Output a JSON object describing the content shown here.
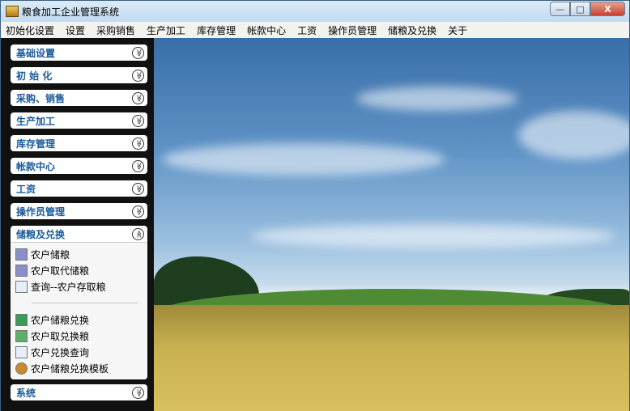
{
  "window": {
    "title": "粮食加工企业管理系统",
    "minimize": "—",
    "maximize": "□",
    "close": "X"
  },
  "menu": [
    "初始化设置",
    "设置",
    "采购销售",
    "生产加工",
    "库存管理",
    "帐款中心",
    "工资",
    "操作员管理",
    "储粮及兑换",
    "关于"
  ],
  "sidebar": {
    "panels": [
      "基础设置",
      "初 始 化",
      "采购、销售",
      "生产加工",
      "库存管理",
      "帐款中心",
      "工资",
      "操作员管理"
    ],
    "expanded": {
      "label": "储粮及兑换",
      "group1": [
        {
          "label": "农户储粮",
          "icon": "folder-icon"
        },
        {
          "label": "农户取代储粮",
          "icon": "folder-icon"
        },
        {
          "label": "查询--农户存取粮",
          "icon": "document-search-icon"
        }
      ],
      "group2": [
        {
          "label": "农户储粮兑换",
          "icon": "exchange-icon"
        },
        {
          "label": "农户取兑换粮",
          "icon": "exchange-out-icon"
        },
        {
          "label": "农户兑换查询",
          "icon": "document-search-icon"
        },
        {
          "label": "农户储粮兑换模板",
          "icon": "gear-icon"
        }
      ]
    },
    "last": "系统",
    "chev_down": "≫",
    "chev_up": "≪"
  }
}
